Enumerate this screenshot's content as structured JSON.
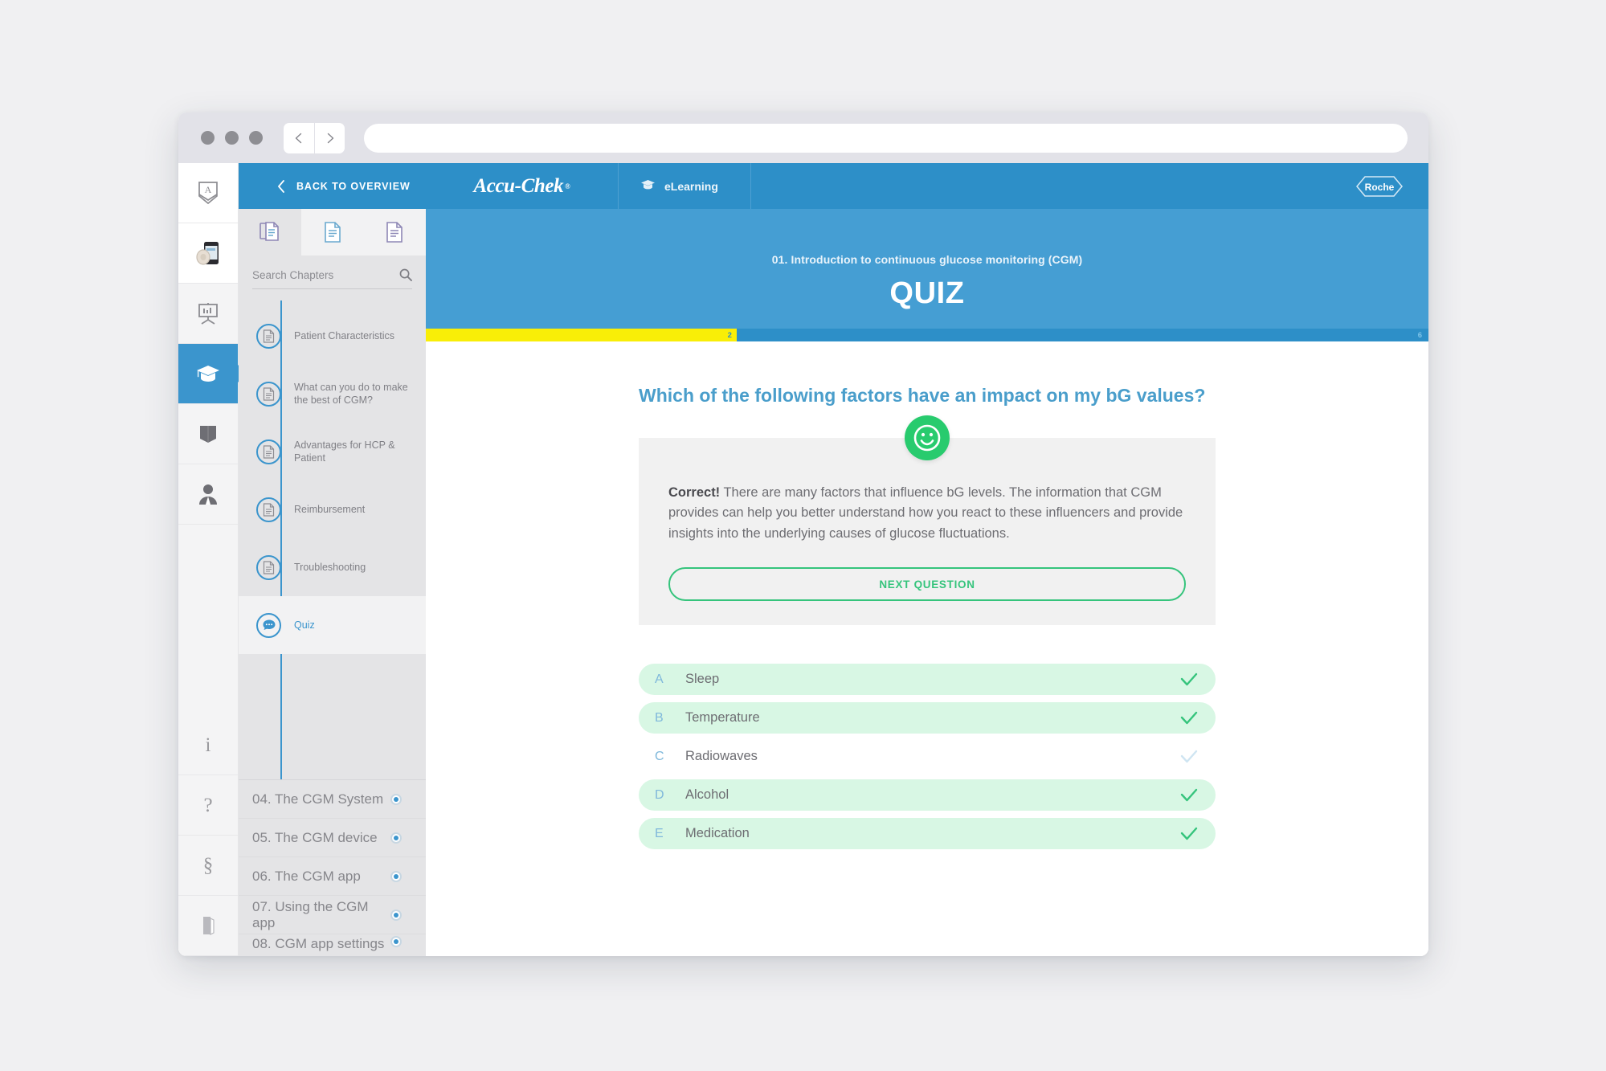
{
  "browser": {
    "url_value": "",
    "url_placeholder": "",
    "back_label": "‹",
    "forward_label": "›"
  },
  "rail": {
    "items": [
      {
        "name": "badge-a-icon",
        "label": ""
      },
      {
        "name": "cgm-device-icon",
        "label": ""
      },
      {
        "name": "presentation-board-icon",
        "label": ""
      },
      {
        "name": "graduation-cap-icon",
        "label": "",
        "active": true
      },
      {
        "name": "book-icon",
        "label": ""
      },
      {
        "name": "person-icon",
        "label": ""
      }
    ],
    "bottom_items": [
      {
        "name": "info-icon",
        "glyph": "i"
      },
      {
        "name": "help-icon",
        "glyph": "?"
      },
      {
        "name": "section-legal-icon",
        "glyph": "§"
      },
      {
        "name": "exit-door-icon",
        "glyph": "⬛"
      }
    ]
  },
  "sidebar": {
    "back_label": "BACK TO OVERVIEW",
    "tabs": [
      {
        "name": "tab-all-documents",
        "active": true
      },
      {
        "name": "tab-document",
        "active": false
      },
      {
        "name": "tab-document-alt",
        "active": false
      }
    ],
    "search": {
      "placeholder": "Search Chapters",
      "value": ""
    },
    "steps": [
      {
        "label": "Patient Characteristics",
        "icon": "document-icon",
        "current": false
      },
      {
        "label": "What can you do to make the best of CGM?",
        "icon": "document-icon",
        "current": false
      },
      {
        "label": "Advantages for HCP & Patient",
        "icon": "document-icon",
        "current": false
      },
      {
        "label": "Reimbursement",
        "icon": "document-icon",
        "current": false
      },
      {
        "label": "Troubleshooting",
        "icon": "document-icon",
        "current": false
      },
      {
        "label": "Quiz",
        "icon": "quiz-bubble-icon",
        "current": true
      }
    ],
    "chapters": [
      {
        "label": "04. The CGM System"
      },
      {
        "label": "05. The CGM device"
      },
      {
        "label": "06. The CGM app"
      },
      {
        "label": "07. Using the CGM app"
      },
      {
        "label": "08. CGM app settings"
      }
    ]
  },
  "header": {
    "brand": "Accu-Chek",
    "brand_trademark": "®",
    "section": "eLearning",
    "logo": "Roche"
  },
  "hero": {
    "module": "01. Introduction to continuous glucose monitoring (CGM)",
    "title": "QUIZ"
  },
  "progress": {
    "current": "2",
    "total": "6",
    "percent": 31
  },
  "quiz": {
    "question": "Which of the following factors have an impact on my bG values?",
    "feedback_status": "correct",
    "feedback_prefix": "Correct!",
    "feedback_text": " There are many factors that influence bG levels. The information that CGM provides can help you better understand how you react to these influencers and provide insights into the underlying causes of glucose fluctuations.",
    "next_label": "NEXT QUESTION",
    "options": [
      {
        "letter": "A",
        "text": "Sleep",
        "correct": true
      },
      {
        "letter": "B",
        "text": "Temperature",
        "correct": true
      },
      {
        "letter": "C",
        "text": "Radiowaves",
        "correct": false
      },
      {
        "letter": "D",
        "text": "Alcohol",
        "correct": true
      },
      {
        "letter": "E",
        "text": "Medication",
        "correct": true
      }
    ]
  },
  "colors": {
    "brand_blue": "#2d8fc8",
    "hero_blue": "#459ed3",
    "progress_yellow": "#f9ee07",
    "success_green": "#35c47c",
    "smiley_green": "#28cb6e",
    "option_green_bg": "#d8f7e4"
  }
}
